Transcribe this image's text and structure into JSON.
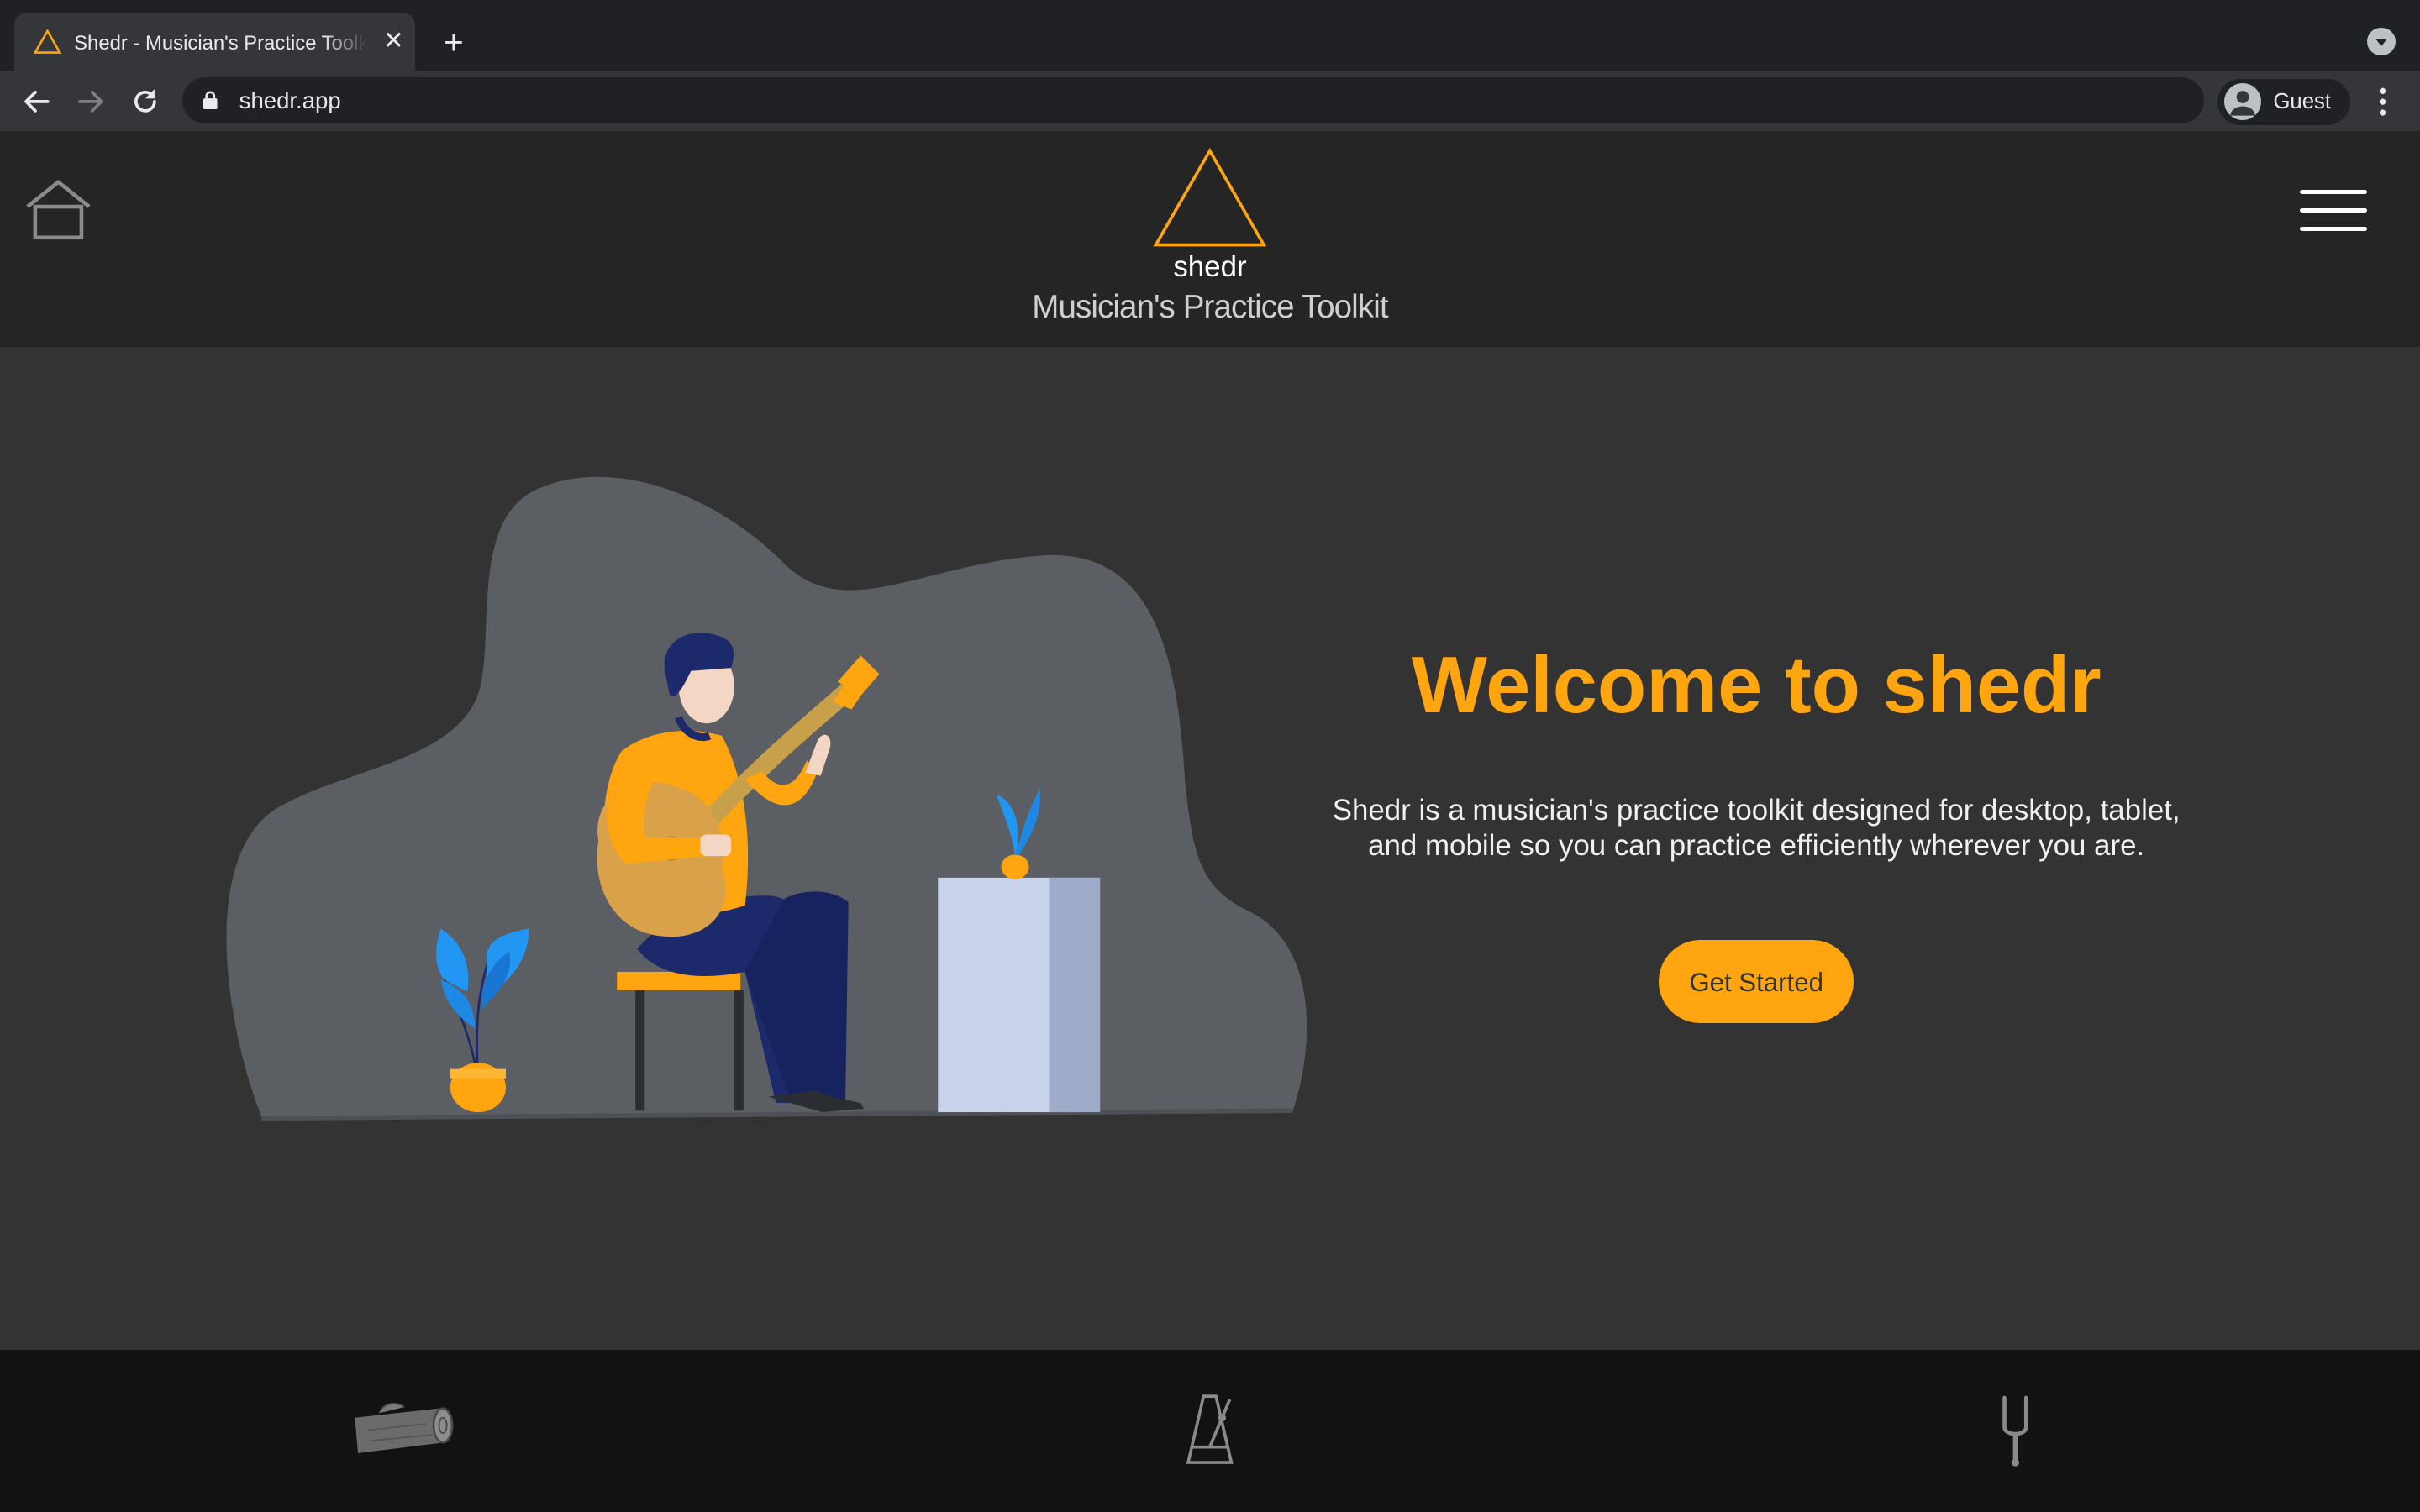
{
  "browser": {
    "tab_title": "Shedr - Musician's Practice Toolkit",
    "tab_close": "✕",
    "new_tab": "+",
    "url": "shedr.app",
    "profile_label": "Guest"
  },
  "header": {
    "brand_name": "shedr",
    "tagline": "Musician's Practice Toolkit"
  },
  "hero": {
    "title": "Welcome to shedr",
    "description": "Shedr is a musician's practice toolkit designed for desktop, tablet, and mobile so you can practice efficiently wherever you are.",
    "cta_label": "Get Started"
  },
  "bottom_nav": {
    "items": [
      {
        "icon": "wood-log-icon"
      },
      {
        "icon": "metronome-icon"
      },
      {
        "icon": "tuning-fork-icon"
      }
    ]
  },
  "colors": {
    "accent": "#ffa510",
    "header_bg": "#252525",
    "page_bg": "#333333",
    "footer_bg": "#121212"
  }
}
